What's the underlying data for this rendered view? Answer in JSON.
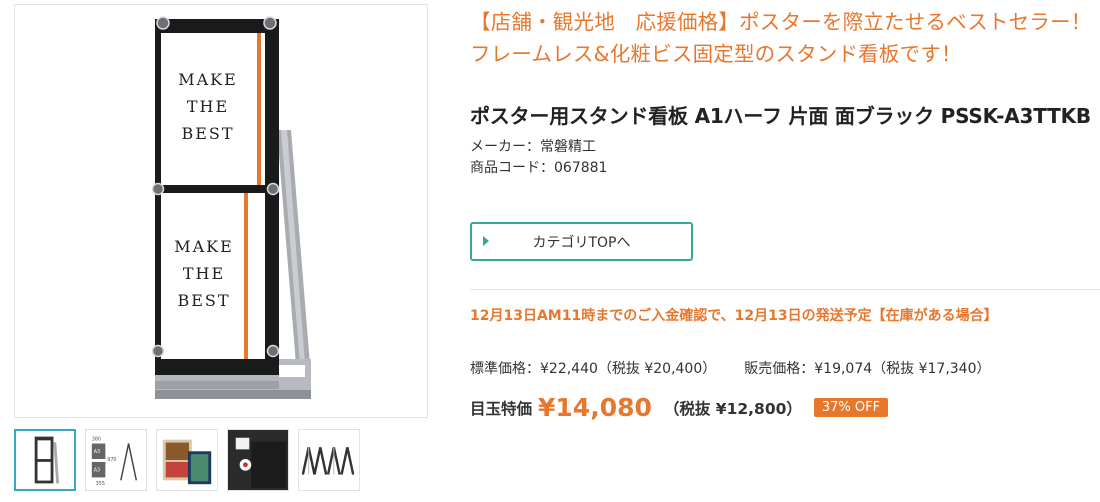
{
  "catch_copy": {
    "line1": "【店舗・観光地　応援価格】ポスターを際立たせるベストセラー！",
    "line2": "フレームレス&化粧ビス固定型のスタンド看板です！"
  },
  "product": {
    "title": "ポスター用スタンド看板 A1ハーフ 片面 面ブラック PSSK-A3TTKB",
    "maker": "メーカー：常磐精工",
    "code": "商品コード：067881"
  },
  "category_button": {
    "label": "カテゴリTOPへ"
  },
  "shipping_notice": "12月13日AM11時までのご入金確認で、12月13日の発送予定【在庫がある場合】",
  "prices": {
    "standard": "標準価格：¥22,440（税抜 ¥20,400）",
    "sale": "販売価格：¥19,074（税抜 ¥17,340）"
  },
  "special_price": {
    "label": "目玉特価",
    "price": "¥14,080",
    "tax": "（税抜 ¥12,800）",
    "discount_badge": "37% OFF"
  },
  "poster_text": {
    "top": [
      "MAKE",
      "THE",
      "BEST"
    ],
    "bottom": [
      "MAKE",
      "THE",
      "BEST"
    ]
  },
  "thumbnail_labels": {
    "dim_top": "380",
    "size_a": "A3",
    "size_b": "A3",
    "dim_side": "970",
    "dim_bottom": "355"
  },
  "colors": {
    "accent_orange": "#e8772e",
    "button_teal": "#3aa59a",
    "thumb_active": "#3aa7c2"
  }
}
